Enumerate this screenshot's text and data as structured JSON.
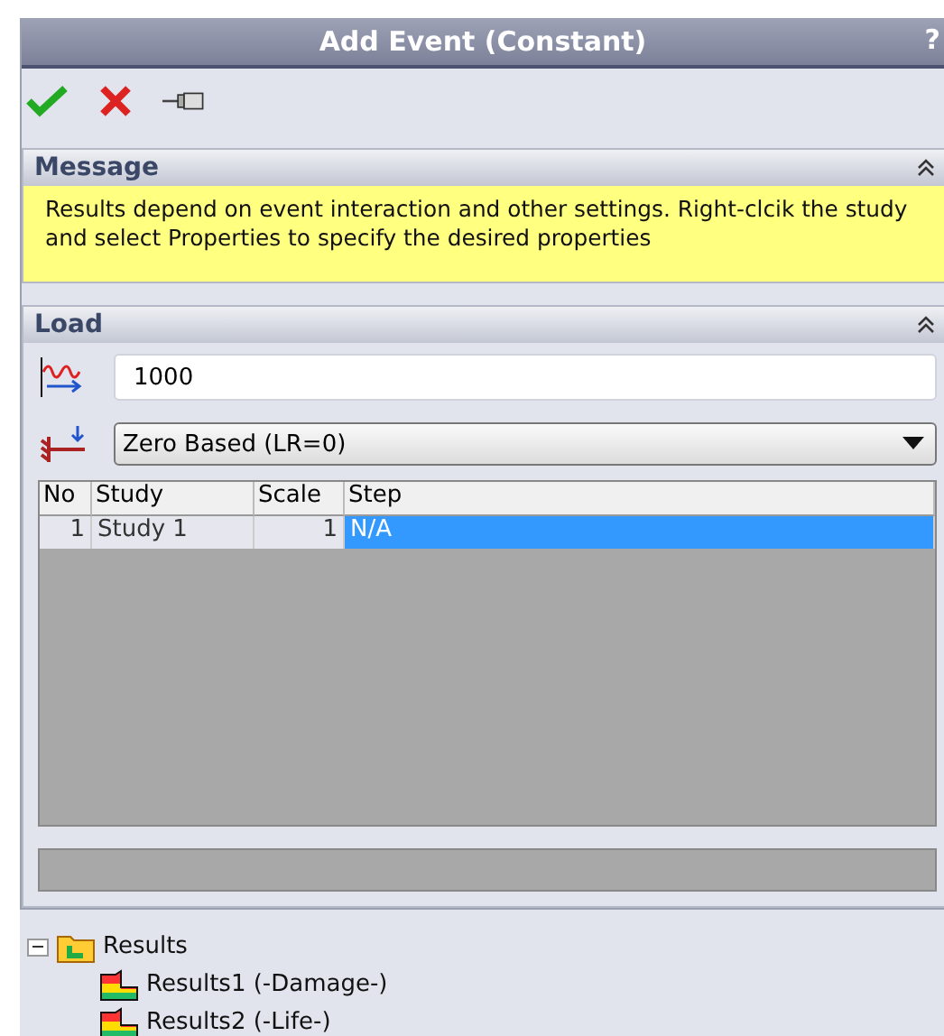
{
  "window": {
    "title": "Add Event (Constant)",
    "help": "?"
  },
  "message": {
    "title": "Message",
    "text": "Results depend on event interaction and other settings. Right-clcik the study and select Properties to specify the desired properties",
    "expanded": true
  },
  "load": {
    "title": "Load",
    "expanded": true,
    "cycles": {
      "value": "1000"
    },
    "load_ratio": {
      "value": "Zero Based (LR=0)"
    },
    "table": {
      "columns": [
        "No",
        "Study",
        "Scale",
        "Step"
      ],
      "rows": [
        {
          "cells": [
            "1",
            "Study 1",
            "1",
            "N/A"
          ],
          "selected": true
        }
      ]
    }
  },
  "tree": [
    {
      "label": "Results",
      "expanded": true,
      "children": [
        {
          "label": "Results1 (-Damage-)"
        },
        {
          "label": "Results2 (-Life-)"
        }
      ]
    }
  ]
}
